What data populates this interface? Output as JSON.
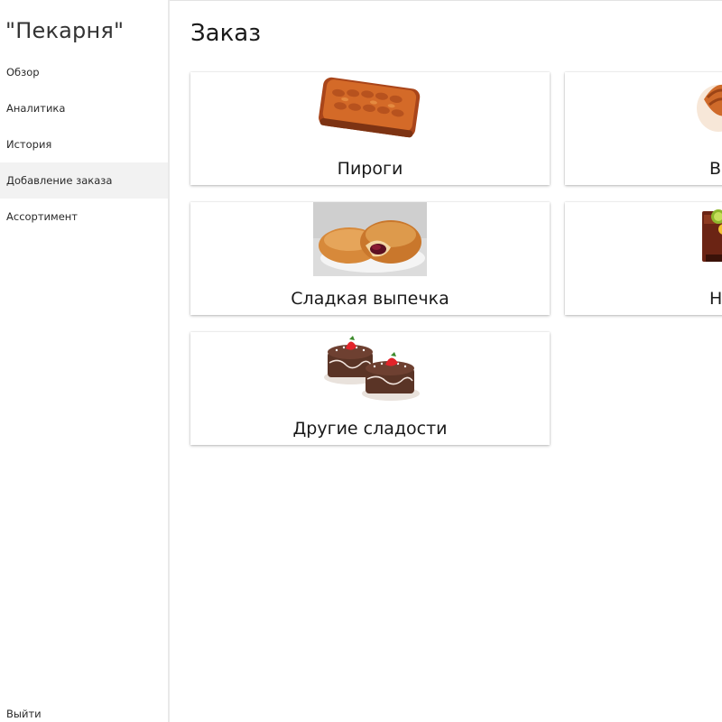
{
  "app": {
    "title": "\"Пекарня\""
  },
  "sidebar": {
    "items": [
      {
        "label": "Обзор"
      },
      {
        "label": "Аналитика"
      },
      {
        "label": "История"
      },
      {
        "label": "Добавление заказа",
        "active": true
      },
      {
        "label": "Ассортимент"
      }
    ],
    "logout_label": "Выйти"
  },
  "main": {
    "title": "Заказ",
    "categories": [
      {
        "label": "Пироги",
        "icon": "pie-image"
      },
      {
        "label": "Вы",
        "icon": "baked-goods-image"
      },
      {
        "label": "Сладкая выпечка",
        "icon": "sweet-bun-image"
      },
      {
        "label": "Н",
        "icon": "drinks-image"
      },
      {
        "label": "Другие сладости",
        "icon": "cakes-image"
      }
    ]
  },
  "colors": {
    "sidebar_active": "#f2f2f2",
    "pie_crust": "#c85a1e",
    "bun": "#d98a3a",
    "chocolate": "#5a3426",
    "strawberry": "#e2242a"
  }
}
